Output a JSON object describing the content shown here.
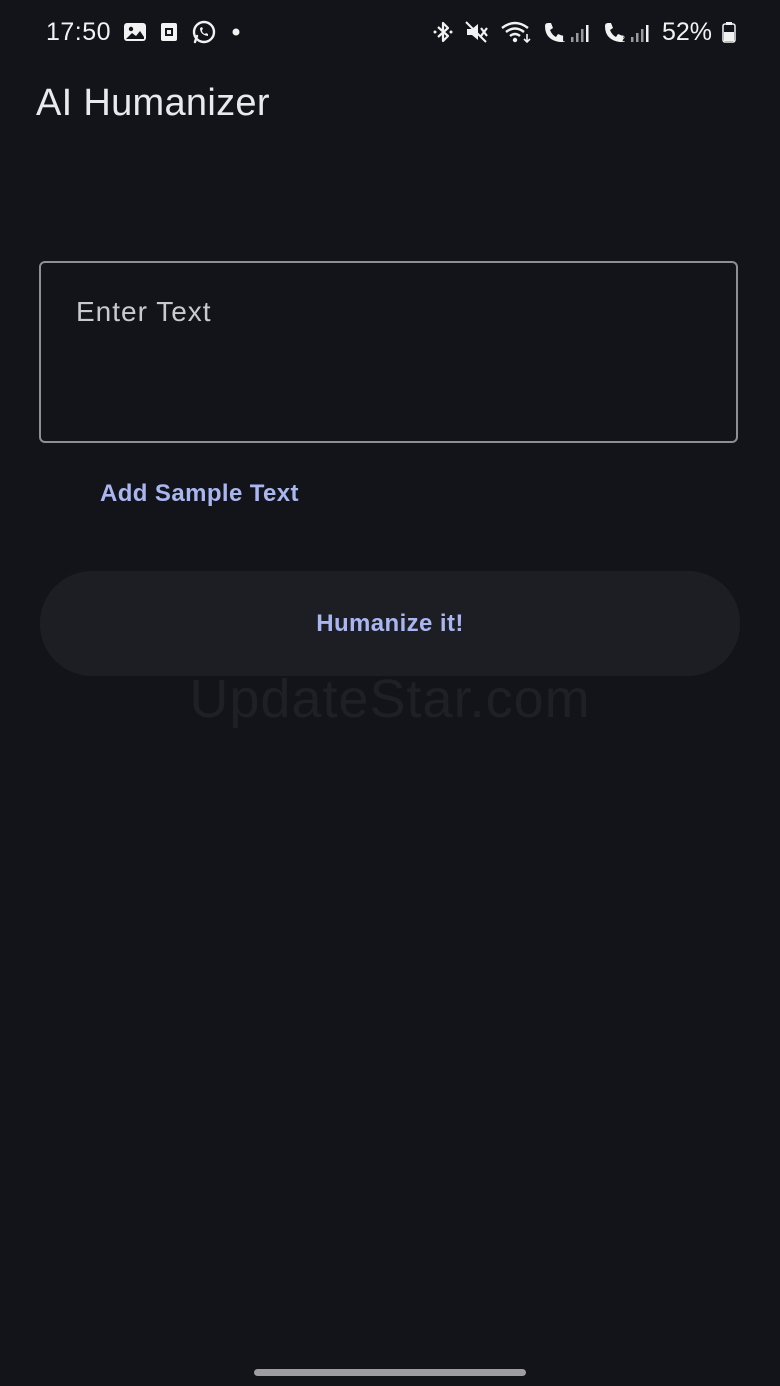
{
  "status_bar": {
    "time": "17:50",
    "battery": "52%",
    "left_icons": [
      "gallery-icon",
      "screenshot-icon",
      "whatsapp-icon",
      "dot-icon"
    ],
    "right_icons": [
      "bluetooth-icon",
      "mute-icon",
      "wifi-icon",
      "volte1-signal-icon",
      "volte2-signal-icon",
      "battery-icon"
    ]
  },
  "app_bar": {
    "title": "AI Humanizer"
  },
  "input": {
    "placeholder": "Enter Text",
    "value": ""
  },
  "actions": {
    "sample_link": "Add Sample Text",
    "humanize_button": "Humanize it!"
  },
  "watermark": "UpdateStar.com",
  "colors": {
    "background": "#131419",
    "accent": "#a9b6f0",
    "button_bg": "#1d1e23",
    "field_border": "#8e8e95"
  }
}
